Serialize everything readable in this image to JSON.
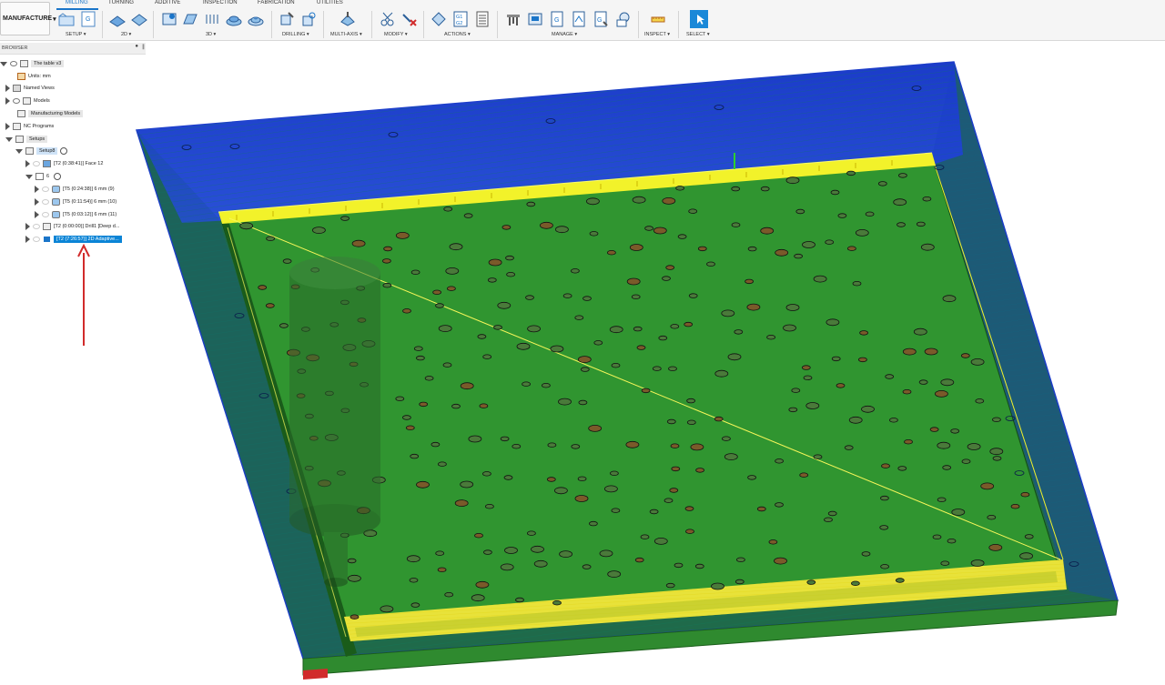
{
  "toolbar": {
    "workspace": "MANUFACTURE",
    "tabs": [
      "MILLING",
      "TURNING",
      "ADDITIVE",
      "INSPECTION",
      "FABRICATION",
      "UTILITIES"
    ],
    "groups": [
      "SETUP",
      "2D",
      "3D",
      "DRILLING",
      "MULTI-AXIS",
      "MODIFY",
      "ACTIONS",
      "MANAGE",
      "INSPECT",
      "SELECT"
    ]
  },
  "browser": {
    "title": "BROWSER",
    "nodes": [
      "The table v3",
      "Units: mm",
      "Named Views",
      "Models",
      "Manufacturing Models",
      "NC Programs",
      "Setups",
      "Setup8",
      "[T2 (0:38:41)] Face 12",
      "6",
      "[T5 (0:24:38)] 6 mm (9)",
      "[T5 (0:11:54)] 6 mm (10)",
      "[T5 (0:03:12)] 6 mm (11)",
      "[T2 (0:00:00)] Drill1 [Deep d...",
      "[T2 (7:26:57)] 2D Adaptive..."
    ]
  },
  "icons": {
    "arrow": "red-annotation-arrow"
  },
  "colors": {
    "accent": "#1a75c9",
    "selected": "#0a84d6",
    "part_green": "#2e8b2e",
    "toolpath_blue": "#1a3cc8",
    "toolpath_yellow": "#f2f22a",
    "annotation_red": "#d12b2b"
  }
}
